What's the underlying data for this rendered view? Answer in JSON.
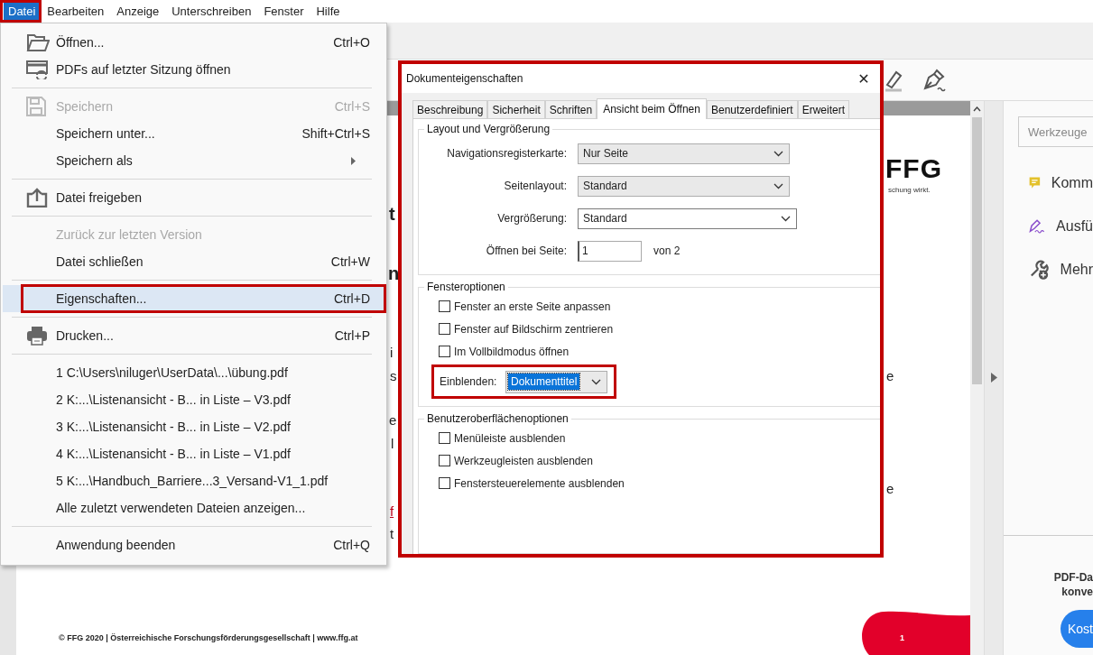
{
  "menubar": [
    {
      "label": "Datei",
      "selected": true,
      "annotated": true
    },
    {
      "label": "Bearbeiten",
      "selected": false,
      "annotated": false
    },
    {
      "label": "Anzeige",
      "selected": false,
      "annotated": false
    },
    {
      "label": "Unterschreiben",
      "selected": false,
      "annotated": false
    },
    {
      "label": "Fenster",
      "selected": false,
      "annotated": false
    },
    {
      "label": "Hilfe",
      "selected": false,
      "annotated": false
    }
  ],
  "file_menu": {
    "items": [
      {
        "kind": "item",
        "label": "Öffnen...",
        "shortcut": "Ctrl+O",
        "disabled": false,
        "selected": false,
        "annotated": false,
        "submenu": false
      },
      {
        "kind": "item",
        "label": "PDFs auf letzter Sitzung öffnen",
        "disabled": false,
        "selected": false,
        "annotated": false,
        "submenu": false
      },
      {
        "kind": "separator"
      },
      {
        "kind": "item",
        "label": "Speichern",
        "shortcut": "Ctrl+S",
        "disabled": true,
        "selected": false,
        "annotated": false,
        "submenu": false
      },
      {
        "kind": "item",
        "label": "Speichern unter...",
        "shortcut": "Shift+Ctrl+S",
        "disabled": false,
        "selected": false,
        "annotated": false,
        "submenu": false
      },
      {
        "kind": "item",
        "label": "Speichern als",
        "disabled": false,
        "selected": false,
        "annotated": false,
        "submenu": true
      },
      {
        "kind": "separator"
      },
      {
        "kind": "item",
        "label": "Datei freigeben",
        "disabled": false,
        "selected": false,
        "annotated": false,
        "submenu": false
      },
      {
        "kind": "separator"
      },
      {
        "kind": "item",
        "label": "Zurück zur letzten Version",
        "disabled": true,
        "selected": false,
        "annotated": false,
        "submenu": false
      },
      {
        "kind": "item",
        "label": "Datei schließen",
        "shortcut": "Ctrl+W",
        "disabled": false,
        "selected": false,
        "annotated": false,
        "submenu": false
      },
      {
        "kind": "separator"
      },
      {
        "kind": "item",
        "label": "Eigenschaften...",
        "shortcut": "Ctrl+D",
        "disabled": false,
        "selected": true,
        "annotated": true,
        "submenu": false
      },
      {
        "kind": "separator"
      },
      {
        "kind": "item",
        "label": "Drucken...",
        "shortcut": "Ctrl+P",
        "disabled": false,
        "selected": false,
        "annotated": false,
        "submenu": false
      },
      {
        "kind": "separator"
      },
      {
        "kind": "item",
        "label": "1 C:\\Users\\niluger\\UserData\\...\\übung.pdf",
        "disabled": false,
        "selected": false,
        "annotated": false,
        "submenu": false
      },
      {
        "kind": "item",
        "label": "2 K:...\\Listenansicht - B... in Liste – V3.pdf",
        "disabled": false,
        "selected": false,
        "annotated": false,
        "submenu": false
      },
      {
        "kind": "item",
        "label": "3 K:...\\Listenansicht - B... in Liste – V2.pdf",
        "disabled": false,
        "selected": false,
        "annotated": false,
        "submenu": false
      },
      {
        "kind": "item",
        "label": "4 K:...\\Listenansicht - B... in Liste – V1.pdf",
        "disabled": false,
        "selected": false,
        "annotated": false,
        "submenu": false
      },
      {
        "kind": "item",
        "label": "5 K:...\\Handbuch_Barriere...3_Versand-V1_1.pdf",
        "disabled": false,
        "selected": false,
        "annotated": false,
        "submenu": false
      },
      {
        "kind": "item",
        "label": "Alle zuletzt verwendeten Dateien anzeigen...",
        "disabled": false,
        "selected": false,
        "annotated": false,
        "submenu": false
      },
      {
        "kind": "separator"
      },
      {
        "kind": "item",
        "label": "Anwendung beenden",
        "shortcut": "Ctrl+Q",
        "disabled": false,
        "selected": false,
        "annotated": false,
        "submenu": false
      }
    ]
  },
  "dialog": {
    "title": "Dokumenteigenschaften",
    "close": "✕",
    "annotated": true,
    "tabs": [
      {
        "label": "Beschreibung",
        "selected": false
      },
      {
        "label": "Sicherheit",
        "selected": false
      },
      {
        "label": "Schriften",
        "selected": false
      },
      {
        "label": "Ansicht beim Öffnen",
        "selected": true
      },
      {
        "label": "Benutzerdefiniert",
        "selected": false
      },
      {
        "label": "Erweitert",
        "selected": false
      }
    ],
    "groups": [
      {
        "title": "Layout und Vergrößerung",
        "rows": [
          {
            "kind": "select",
            "label": "Navigationsregisterkarte:",
            "value": "Nur Seite"
          },
          {
            "kind": "select",
            "label": "Seitenlayout:",
            "value": "Standard"
          },
          {
            "kind": "combo",
            "label": "Vergrößerung:",
            "value": "Standard"
          },
          {
            "kind": "page",
            "label": "Öffnen bei Seite:",
            "value": "1",
            "suffix": "von 2"
          }
        ]
      },
      {
        "title": "Fensteroptionen",
        "rows": [
          {
            "kind": "checkbox",
            "label": "Fenster an erste Seite anpassen",
            "checked": false
          },
          {
            "kind": "checkbox",
            "label": "Fenster auf Bildschirm zentrieren",
            "checked": false
          },
          {
            "kind": "checkbox",
            "label": "Im Vollbildmodus öffnen",
            "checked": false
          },
          {
            "kind": "inline_select",
            "label": "Einblenden:",
            "value": "Dokumenttitel",
            "focused": true,
            "annotated": true
          }
        ]
      },
      {
        "title": "Benutzeroberflächenoptionen",
        "rows": [
          {
            "kind": "checkbox",
            "label": "Menüleiste ausblenden",
            "checked": false
          },
          {
            "kind": "checkbox",
            "label": "Werkzeugleisten ausblenden",
            "checked": false
          },
          {
            "kind": "checkbox",
            "label": "Fenstersteuerelemente ausblenden",
            "checked": false
          }
        ]
      }
    ]
  },
  "document": {
    "logo": "FFG",
    "tagline": "schung wirkt.",
    "fragments": [
      "t",
      "n",
      "i",
      "s",
      "e",
      "l",
      "f",
      "t",
      "e",
      "e"
    ],
    "footer": "© FFG 2020 | Österreichische Forschungsförderungsgesellschaft | www.ffg.at",
    "page_number": "1"
  },
  "tools_panel": {
    "search": {
      "placeholder": "Werkzeuge"
    },
    "tools": [
      {
        "label": "Komm"
      },
      {
        "label": "Ausfü"
      },
      {
        "label": "Mehr"
      }
    ],
    "promo": [
      "PDF-Da",
      "konve"
    ],
    "button": "Kost"
  }
}
